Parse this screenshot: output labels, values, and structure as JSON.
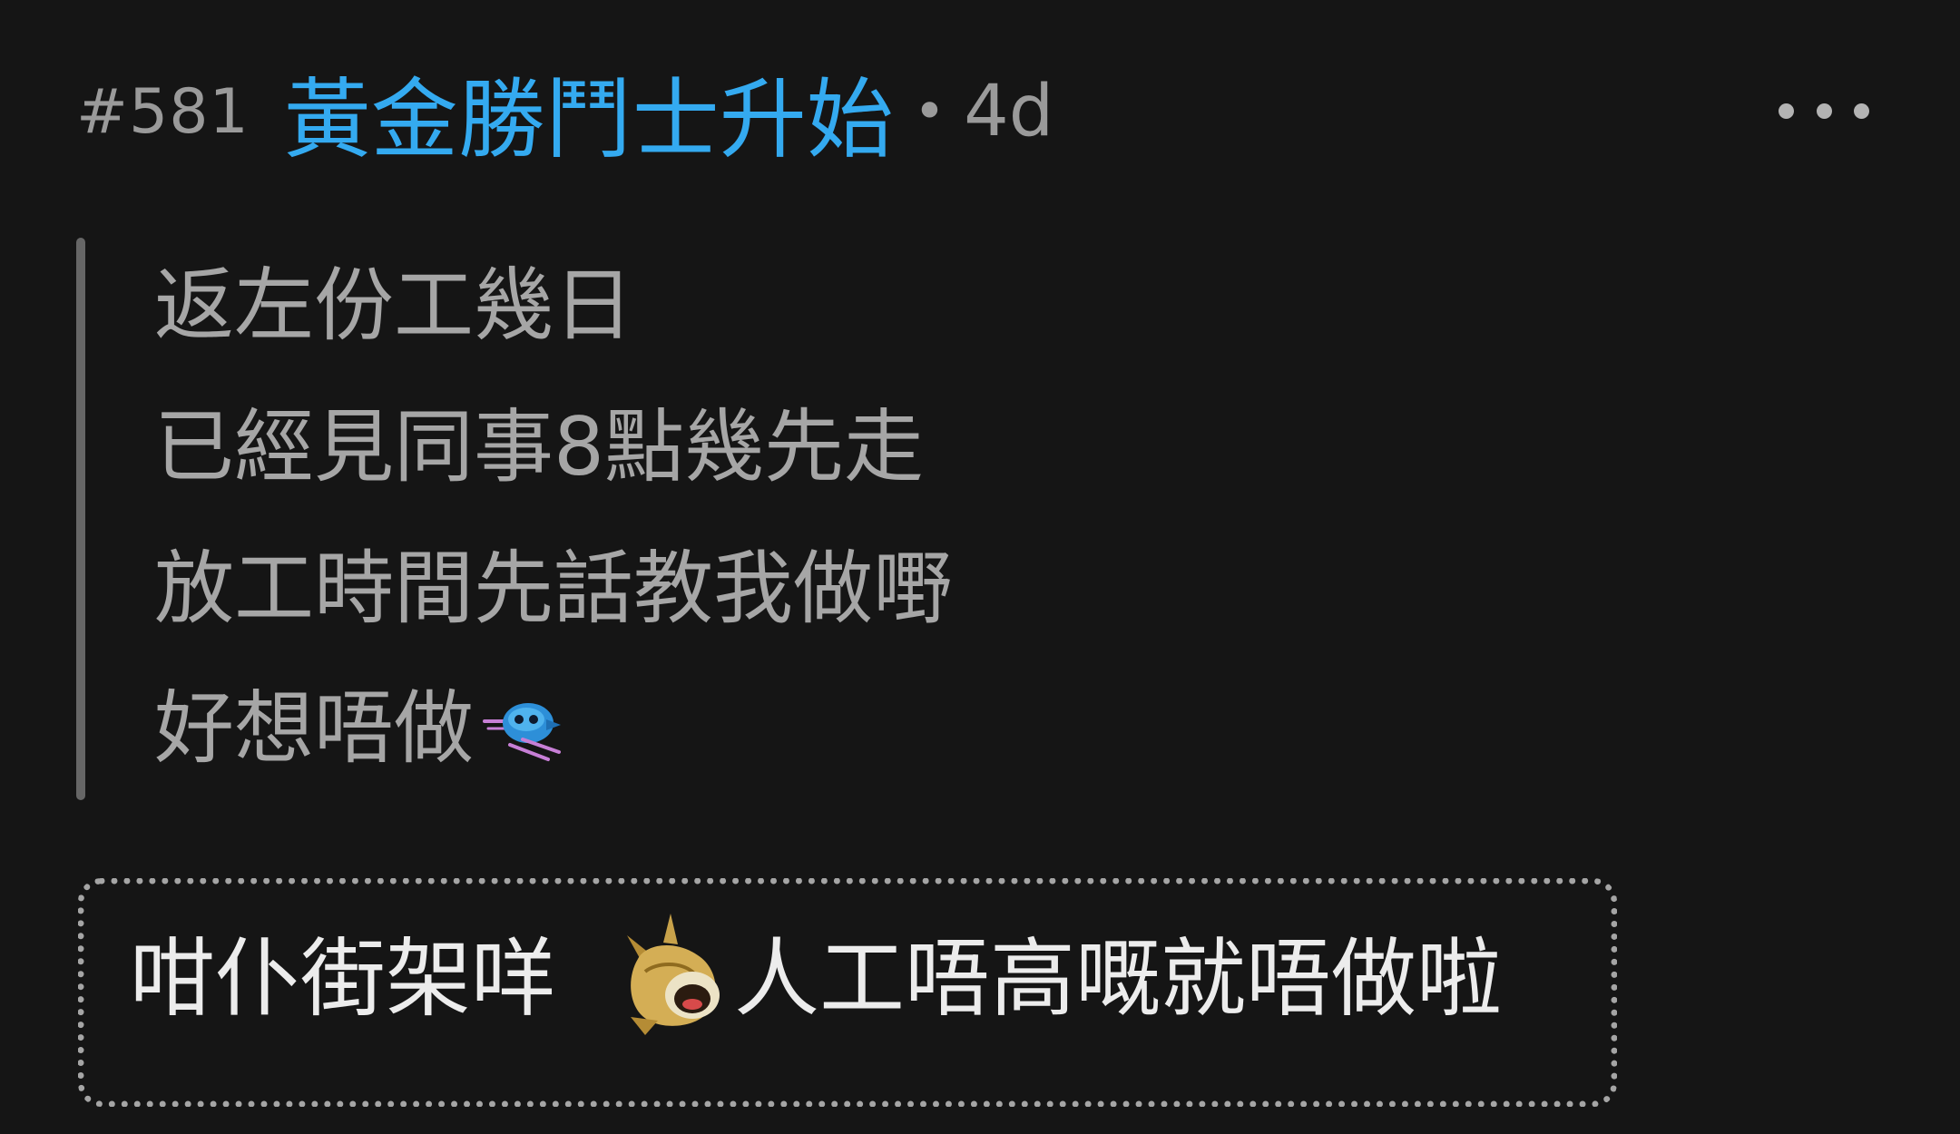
{
  "post": {
    "number": "#581",
    "username": "黃金勝鬥士升始",
    "separator": "•",
    "time_ago": "4d",
    "more_icon": "ellipsis-icon"
  },
  "quote": {
    "lines": [
      "返左份工幾日",
      "已經見同事8點幾先走",
      "放工時間先話教我做嘢",
      "好想唔做"
    ],
    "emoji": "blue-bird-sticker"
  },
  "reply": {
    "text_before": "咁仆街架咩",
    "emoji": "golden-horse-sticker",
    "text_after": "人工唔高嘅就唔做啦"
  },
  "colors": {
    "background": "#151515",
    "username": "#34aaf0",
    "muted": "#9a9a9a"
  }
}
